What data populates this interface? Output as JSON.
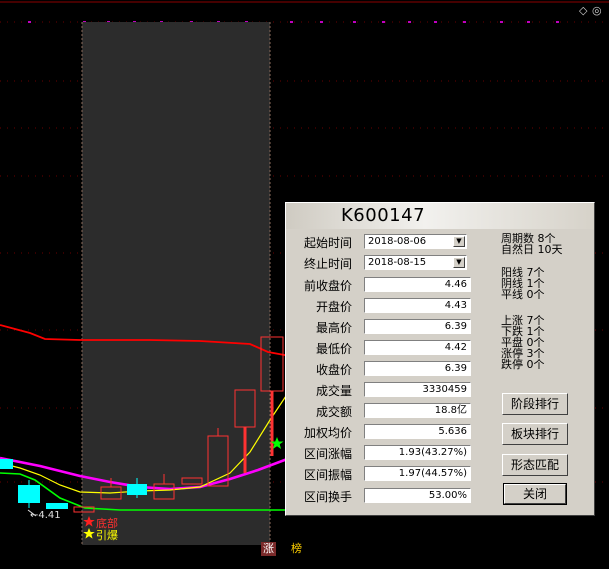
{
  "chart_labels": {
    "left_price_label": "←4.41",
    "bottom_label": "底部",
    "detonate_label": "引爆",
    "zhang_tag": "涨",
    "bang_tag": "榜"
  },
  "toolbar": {
    "diamond_icon": "diamond-icon",
    "target_icon": "target-icon"
  },
  "colors": {
    "up": "#ff3232",
    "down": "#00ffff",
    "ma_yellow": "#ffff00",
    "ma_magenta": "#ff00ff",
    "ma_green": "#00ff00",
    "ma_red": "#ff0000",
    "selection": "#2c2c2c"
  },
  "dialog": {
    "title": "K600147",
    "start_label": "起始时间",
    "start_value": "2018-08-06",
    "end_label": "终止时间",
    "end_value": "2018-08-15",
    "fields": [
      {
        "label": "前收盘价",
        "value": "4.46"
      },
      {
        "label": "开盘价",
        "value": "4.43"
      },
      {
        "label": "最高价",
        "value": "6.39"
      },
      {
        "label": "最低价",
        "value": "4.42"
      },
      {
        "label": "收盘价",
        "value": "6.39"
      },
      {
        "label": "成交量",
        "value": "3330459"
      },
      {
        "label": "成交额",
        "value": "18.8亿"
      },
      {
        "label": "加权均价",
        "value": "5.636"
      },
      {
        "label": "区间涨幅",
        "value": "1.93(43.27%)"
      },
      {
        "label": "区间振幅",
        "value": "1.97(44.57%)"
      },
      {
        "label": "区间换手",
        "value": "53.00%"
      }
    ],
    "stats": {
      "periods": "周期数 8个",
      "natural_days": "自然日 10天",
      "yang": "阳线 7个",
      "yin": "阴线 1个",
      "flat": "平线 0个",
      "up": "上涨 7个",
      "down": "下跌 1个",
      "flat2": "平盘 0个",
      "limit_up": "涨停 3个",
      "limit_down": "跌停 0个"
    },
    "buttons": {
      "stage_rank": "阶段排行",
      "sector_rank": "板块排行",
      "pattern_match": "形态匹配",
      "close": "关闭"
    }
  }
}
